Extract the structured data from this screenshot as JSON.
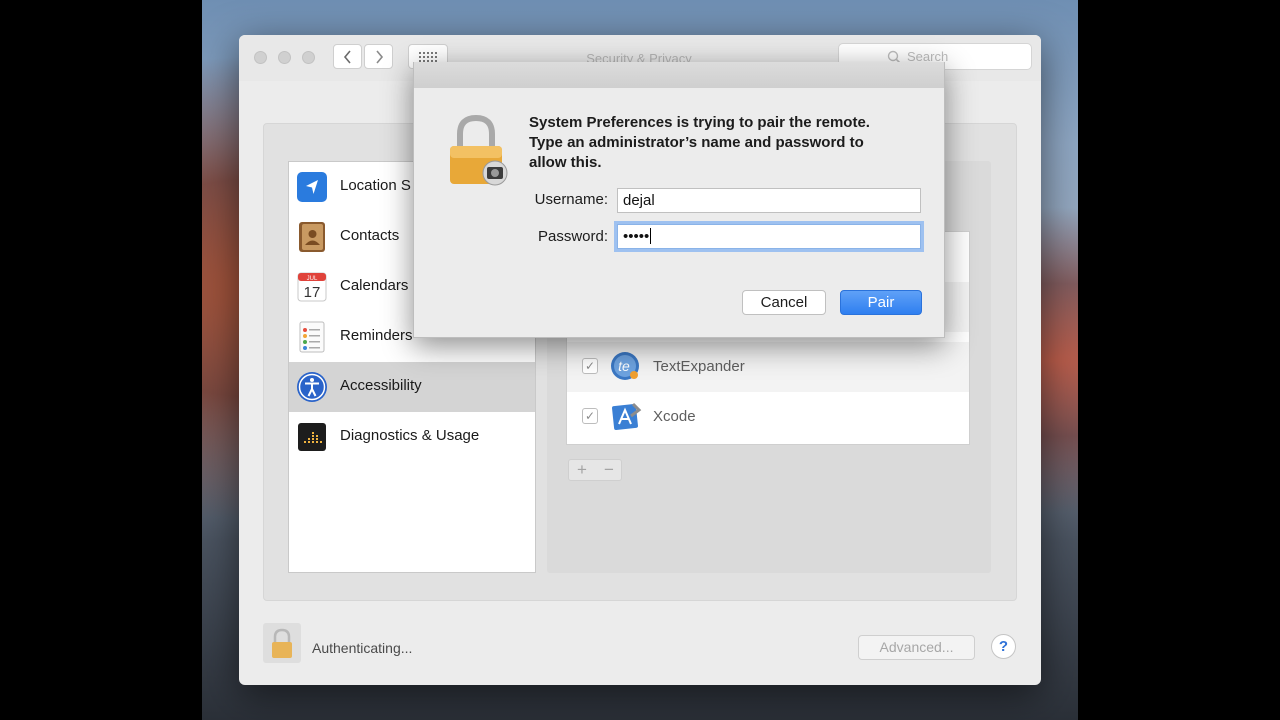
{
  "window": {
    "title": "Security & Privacy",
    "search_placeholder": "Search",
    "nav_back_icon": "chevron-left-icon",
    "nav_forward_icon": "chevron-right-icon",
    "show_all_icon": "grid-icon"
  },
  "sidebar": {
    "items": [
      {
        "label": "Location S",
        "icon": "location-arrow-icon"
      },
      {
        "label": "Contacts",
        "icon": "contacts-book-icon"
      },
      {
        "label": "Calendars",
        "icon": "calendar-icon",
        "calendar_month": "JUL",
        "calendar_day": "17"
      },
      {
        "label": "Reminders",
        "icon": "reminders-list-icon"
      },
      {
        "label": "Accessibility",
        "icon": "accessibility-icon",
        "selected": true
      },
      {
        "label": "Diagnostics & Usage",
        "icon": "diagnostics-icon"
      }
    ]
  },
  "apps": {
    "rows": [
      {
        "name": "TextExpander",
        "checked": true,
        "icon": "textexpander-icon"
      },
      {
        "name": "Xcode",
        "checked": true,
        "icon": "xcode-icon"
      }
    ],
    "add_label": "+",
    "remove_label": "−"
  },
  "footer": {
    "status": "Authenticating...",
    "advanced_label": "Advanced...",
    "help_label": "?"
  },
  "dialog": {
    "message_lines": [
      "System Preferences is trying to pair the remote.",
      "Type an administrator’s name and password to",
      "allow this."
    ],
    "username_label": "Username:",
    "username_value": "dejal",
    "password_label": "Password:",
    "password_masked": "•••••",
    "cancel_label": "Cancel",
    "pair_label": "Pair"
  },
  "colors": {
    "accent": "#2f7ff0",
    "focus_ring": "#9ec1f0",
    "lock_gold": "#e8a838"
  }
}
